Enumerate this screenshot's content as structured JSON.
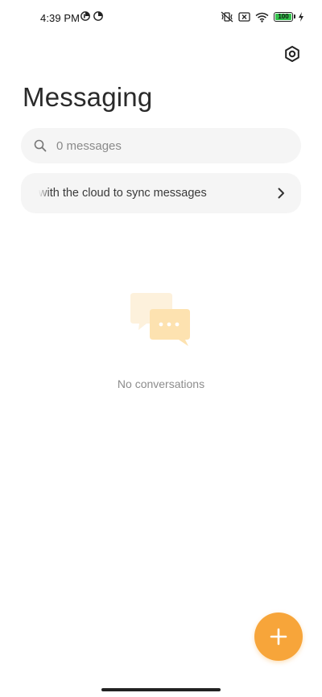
{
  "status_bar": {
    "time": "4:39 PM",
    "battery": "100",
    "icons": [
      "app-notification-icon",
      "app-notification-icon",
      "vibrate-off-icon",
      "sim-off-icon",
      "wifi-icon",
      "battery-icon",
      "charging-icon"
    ]
  },
  "header": {
    "title": "Messaging",
    "settings_icon": "settings-hex-icon"
  },
  "search": {
    "placeholder": "0 messages",
    "value": "",
    "icon": "search-icon"
  },
  "sync_banner": {
    "label": "with the cloud to sync messages",
    "icon": "chevron-right-icon"
  },
  "empty_state": {
    "message": "No conversations",
    "icon": "chat-bubbles-icon"
  },
  "fab": {
    "icon": "plus-icon"
  },
  "colors": {
    "accent": "#f7a53a",
    "surface": "#f5f5f5",
    "battery_fill": "#33c14b",
    "illustration_light": "#fdf1dc",
    "illustration_main": "#fde2b0"
  }
}
